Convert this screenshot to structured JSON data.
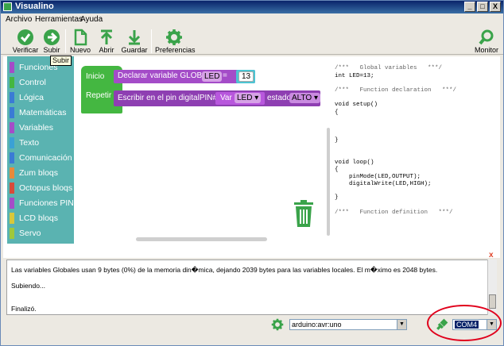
{
  "window": {
    "title": "Visualino",
    "minimize": "_",
    "maximize": "□",
    "close": "X"
  },
  "menu": {
    "items": [
      "Archivo",
      "Herramientas",
      "Ayuda"
    ]
  },
  "toolbar": {
    "verify": "Verificar",
    "upload": "Subir",
    "new": "Nuevo",
    "open": "Abrir",
    "save": "Guardar",
    "preferences": "Preferencias",
    "monitor": "Monitor",
    "tooltip": "Subir"
  },
  "categories": [
    {
      "label": "Funciones",
      "color": "#a44cc8"
    },
    {
      "label": "Control",
      "color": "#44b741"
    },
    {
      "label": "Lógica",
      "color": "#3a7bd5"
    },
    {
      "label": "Matemáticas",
      "color": "#3a7bd5"
    },
    {
      "label": "Variables",
      "color": "#a44cc8"
    },
    {
      "label": "Texto",
      "color": "#3aa1d5"
    },
    {
      "label": "Comunicación",
      "color": "#3a7bd5"
    },
    {
      "label": "Zum bloqs",
      "color": "#e88a3a"
    },
    {
      "label": "Octopus bloqs",
      "color": "#d84a3a"
    },
    {
      "label": "Funciones PIN",
      "color": "#a44cc8"
    },
    {
      "label": "LCD bloqs",
      "color": "#d8c83a"
    },
    {
      "label": "Servo",
      "color": "#a0c83a"
    }
  ],
  "blocks": {
    "inicio": "Inicio",
    "repetir": "Repetir",
    "declare_text": "Declarar variable GLOBAL",
    "declare_name": "LED",
    "declare_eq": "=",
    "declare_value": "13",
    "write_text": "Escribir en el pin digitalPIN#",
    "var_label": "Var",
    "var_name": "LED",
    "state_label": "estado",
    "state_value": "ALTO"
  },
  "code": [
    "/***   Global variables   ***/",
    "int LED=13;",
    "/***   Function declaration   ***/",
    "void setup()",
    "{",
    "}",
    "void loop()",
    "{",
    "    pinMode(LED,OUTPUT);",
    "    digitalWrite(LED,HIGH);",
    "}",
    "/***   Function definition   ***/"
  ],
  "console": {
    "close": "x",
    "lines": [
      "Las variables Globales usan 9 bytes (0%) de la memoria din�mica, dejando 2039 bytes para las variables locales. El m�ximo es 2048 bytes.",
      "Subiendo...",
      "Finalizó."
    ]
  },
  "status": {
    "board": "arduino:avr:uno",
    "port": "COM4"
  },
  "colors": {
    "toolbar_icon": "#3aa34a",
    "category_bg": "#5ab3b1",
    "annotation_circle": "#e0001b"
  }
}
